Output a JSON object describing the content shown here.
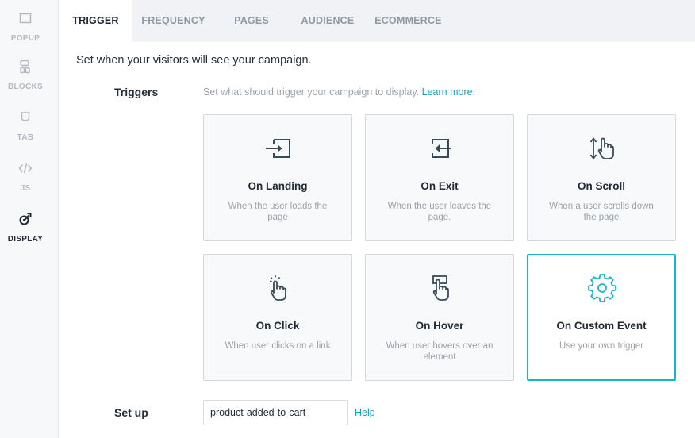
{
  "sidebar": {
    "items": [
      {
        "label": "POPUP",
        "icon": "popup-icon"
      },
      {
        "label": "BLOCKS",
        "icon": "blocks-icon"
      },
      {
        "label": "TAB",
        "icon": "tab-icon"
      },
      {
        "label": "JS",
        "icon": "code-icon"
      },
      {
        "label": "DISPLAY",
        "icon": "display-icon",
        "active": true
      }
    ]
  },
  "tabs": [
    {
      "label": "TRIGGER",
      "active": true
    },
    {
      "label": "FREQUENCY"
    },
    {
      "label": "PAGES"
    },
    {
      "label": "AUDIENCE"
    },
    {
      "label": "ECOMMERCE"
    }
  ],
  "main": {
    "intro": "Set when your visitors will see your campaign.",
    "triggers_label": "Triggers",
    "triggers_desc": "Set what should trigger your campaign to display.",
    "learn_more": "Learn more.",
    "cards": [
      {
        "title": "On Landing",
        "subtitle": "When the user loads the page",
        "icon": "enter-icon"
      },
      {
        "title": "On Exit",
        "subtitle": "When the user leaves the page.",
        "icon": "exit-icon"
      },
      {
        "title": "On Scroll",
        "subtitle": "When a user scrolls down the page",
        "icon": "scroll-icon"
      },
      {
        "title": "On Click",
        "subtitle": "When user clicks on a link",
        "icon": "click-icon"
      },
      {
        "title": "On Hover",
        "subtitle": "When user hovers over an element",
        "icon": "hover-icon"
      },
      {
        "title": "On Custom Event",
        "subtitle": "Use your own trigger",
        "icon": "gear-icon",
        "selected": true
      }
    ],
    "setup_label": "Set up",
    "setup_value": "product-added-to-cart",
    "help": "Help"
  },
  "colors": {
    "accent": "#19b5c4",
    "link": "#17a2b8",
    "icon": "#3b4a5a",
    "muted": "#9aa3ad"
  }
}
